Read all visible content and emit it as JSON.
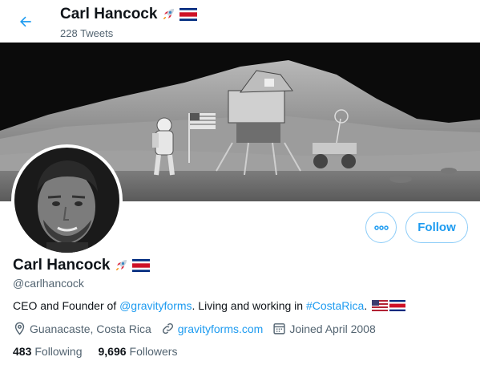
{
  "header": {
    "back_label": "Back",
    "name": "Carl Hancock",
    "tweet_count": "228 Tweets"
  },
  "profile": {
    "name": "Carl Hancock",
    "handle": "@carlhancock",
    "bio": {
      "prefix": "CEO and Founder of ",
      "mention": "@gravityforms",
      "middle": ". Living and working in ",
      "hashtag": "#CostaRica",
      "suffix": "."
    },
    "location": "Guanacaste, Costa Rica",
    "website": "gravityforms.com",
    "joined": "Joined April 2008",
    "following_count": "483",
    "following_label": "Following",
    "followers_count": "9,696",
    "followers_label": "Followers"
  },
  "actions": {
    "follow_label": "Follow"
  },
  "colors": {
    "accent": "#1d9bf0",
    "secondary_text": "#536471",
    "button_border": "#8ecdf8"
  },
  "icons": [
    "back-arrow-icon",
    "rocket-emoji-icon",
    "costa-rica-flag-icon",
    "us-flag-icon",
    "more-icon",
    "location-icon",
    "link-icon",
    "calendar-icon"
  ]
}
